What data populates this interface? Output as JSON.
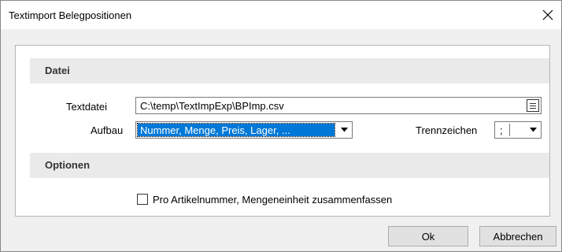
{
  "window": {
    "title": "Textimport Belegpositionen",
    "close_icon": "close-icon"
  },
  "sections": {
    "datei": {
      "label": "Datei"
    },
    "optionen": {
      "label": "Optionen"
    }
  },
  "fields": {
    "textdatei": {
      "label": "Textdatei",
      "value": "C:\\temp\\TextImpExp\\BPImp.csv",
      "browse_icon": "file-browse-icon"
    },
    "aufbau": {
      "label": "Aufbau",
      "selected": "Nummer, Menge, Preis, Lager, ..."
    },
    "trennzeichen": {
      "label": "Trennzeichen",
      "selected": ";"
    }
  },
  "options": {
    "zusammenfassen": {
      "label": "Pro Artikelnummer, Mengeneinheit zusammenfassen",
      "checked": false
    }
  },
  "buttons": {
    "ok": "Ok",
    "cancel": "Abbrechen"
  },
  "colors": {
    "selection": "#0078d7",
    "section_bg": "#eaeaea",
    "window_bg": "#f0f0f0"
  }
}
